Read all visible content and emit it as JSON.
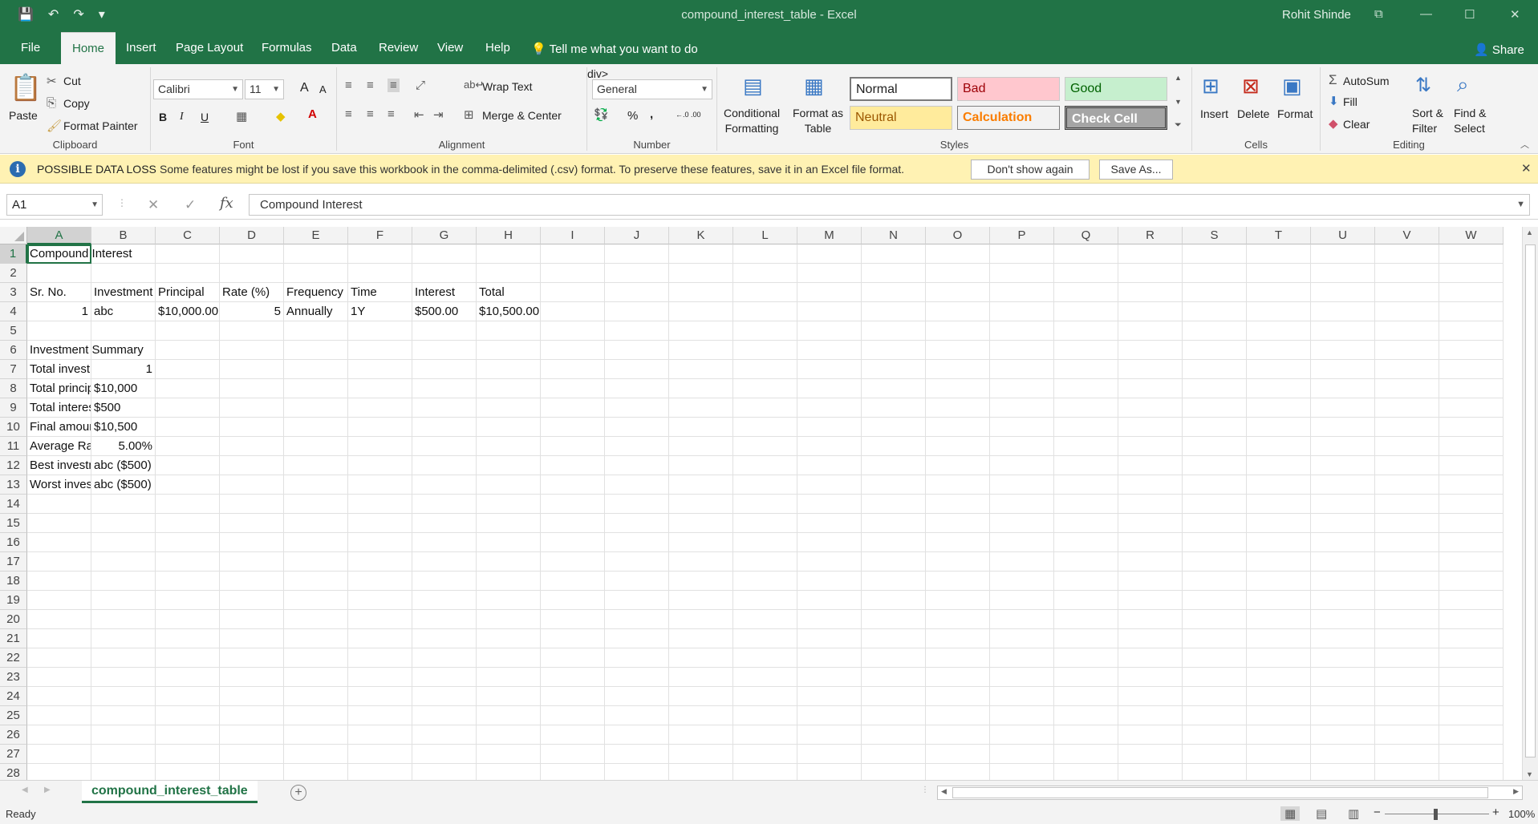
{
  "titlebar": {
    "title": "compound_interest_table  -  Excel",
    "user": "Rohit Shinde",
    "save_icon": "💾",
    "undo_icon": "↶",
    "redo_icon": "↷",
    "customize_icon": "▾",
    "ribbon_display_icon": "⧉",
    "minimize_icon": "—",
    "maximize_icon": "☐",
    "close_icon": "✕"
  },
  "tabs": [
    {
      "label": "File"
    },
    {
      "label": "Home"
    },
    {
      "label": "Insert"
    },
    {
      "label": "Page Layout"
    },
    {
      "label": "Formulas"
    },
    {
      "label": "Data"
    },
    {
      "label": "Review"
    },
    {
      "label": "View"
    },
    {
      "label": "Help"
    }
  ],
  "tellme": "Tell me what you want to do",
  "share": "Share",
  "ribbon": {
    "clipboard": {
      "label": "Clipboard",
      "paste": "Paste",
      "cut": "Cut",
      "copy": "Copy",
      "format_painter": "Format Painter"
    },
    "font": {
      "label": "Font",
      "name": "Calibri",
      "size": "11",
      "bold": "B",
      "italic": "I",
      "underline": "U",
      "grow": "A",
      "shrink": "A"
    },
    "alignment": {
      "label": "Alignment",
      "wrap": "Wrap Text",
      "merge": "Merge & Center"
    },
    "number": {
      "label": "Number",
      "format": "General",
      "percent": "%",
      "comma": ",",
      "inc_dec": "←.0 .00",
      "dec_dec": ".00 →.0"
    },
    "styles": {
      "label": "Styles",
      "conditional": "Conditional\nFormatting",
      "format_as_table": "Format as\nTable",
      "normal": "Normal",
      "bad": "Bad",
      "good": "Good",
      "neutral": "Neutral",
      "calculation": "Calculation",
      "check_cell": "Check Cell"
    },
    "cells": {
      "label": "Cells",
      "insert": "Insert",
      "delete": "Delete",
      "format": "Format"
    },
    "editing": {
      "label": "Editing",
      "autosum": "AutoSum",
      "fill": "Fill",
      "clear": "Clear",
      "sort": "Sort &\nFilter",
      "find": "Find &\nSelect"
    }
  },
  "infobar": {
    "title": "POSSIBLE DATA LOSS",
    "message": "Some features might be lost if you save this workbook in the comma-delimited (.csv) format. To preserve these features, save it in an Excel file format.",
    "dont_show": "Don't show again",
    "save_as": "Save As...",
    "close": "✕"
  },
  "formula_bar": {
    "name_box": "A1",
    "cancel": "✕",
    "enter": "✓",
    "fx": "fx",
    "value": "Compound Interest"
  },
  "columns": [
    "A",
    "B",
    "C",
    "D",
    "E",
    "F",
    "G",
    "H",
    "I",
    "J",
    "K",
    "L",
    "M",
    "N",
    "O",
    "P",
    "Q",
    "R",
    "S",
    "T",
    "U",
    "V",
    "W"
  ],
  "rows": [
    "1",
    "2",
    "3",
    "4",
    "5",
    "6",
    "7",
    "8",
    "9",
    "10",
    "11",
    "12",
    "13",
    "14",
    "15",
    "16",
    "17",
    "18",
    "19",
    "20",
    "21",
    "22",
    "23",
    "24",
    "25",
    "26",
    "27",
    "28"
  ],
  "cells": {
    "A1": "Compound Interest",
    "A3": "Sr. No.",
    "B3": "Investment",
    "C3": "Principal",
    "D3": "Rate (%)",
    "E3": "Frequency",
    "F3": "Time",
    "G3": "Interest",
    "H3": "Total",
    "A4": "1",
    "B4": "abc",
    "C4": "$10,000.00",
    "D4": "5",
    "E4": "Annually",
    "F4": "1Y",
    "G4": "$500.00",
    "H4": "$10,500.00",
    "A6": "Investment Summary",
    "A7": "Total investments",
    "B7": "1",
    "A8": "Total principal",
    "B8": "$10,000",
    "A9": "Total interest",
    "B9": "$500",
    "A10": "Final amount",
    "B10": "$10,500",
    "A11": "Average Rate",
    "B11": "5.00%",
    "A12": "Best investment",
    "B12": "abc ($500)",
    "A13": "Worst investment",
    "B13": "abc ($500)"
  },
  "sheet_tab": "compound_interest_table",
  "add_sheet": "+",
  "status": {
    "ready": "Ready",
    "zoom": "100%",
    "zoom_out": "−",
    "zoom_in": "+"
  }
}
